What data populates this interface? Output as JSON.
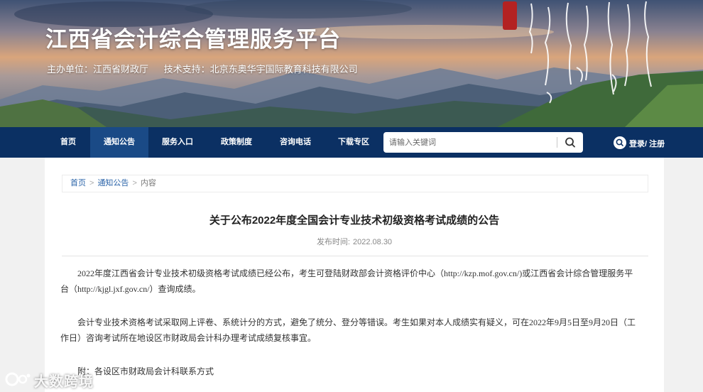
{
  "header": {
    "site_title": "江西省会计综合管理服务平台",
    "organizer": "主办单位：江西省财政厅",
    "tech_support": "技术支持：北京东奥华宇国际教育科技有限公司"
  },
  "nav": {
    "items": [
      {
        "label": "首页"
      },
      {
        "label": "通知公告"
      },
      {
        "label": "服务入口"
      },
      {
        "label": "政策制度"
      },
      {
        "label": "咨询电话"
      },
      {
        "label": "下载专区"
      }
    ],
    "active": "通知公告",
    "search": {
      "placeholder": "请输入关键词",
      "icon": "search-icon"
    },
    "login_label": "登录/ 注册",
    "colors": {
      "bar": "#0b3063",
      "active": "#1a4a86"
    }
  },
  "breadcrumb": {
    "items": [
      "首页",
      "通知公告"
    ],
    "current": "内容",
    "separator": ">"
  },
  "article": {
    "title": "关于公布2022年度全国会计专业技术初级资格考试成绩的公告",
    "publish_label": "发布时间:",
    "publish_date": "2022.08.30",
    "paragraphs": [
      "2022年度江西省会计专业技术初级资格考试成绩已经公布，考生可登陆财政部会计资格评价中心（http://kzp.mof.gov.cn/)或江西省会计综合管理服务平台（http://kjgl.jxf.gov.cn/）查询成绩。",
      "会计专业技术资格考试采取网上评卷、系统计分的方式，避免了统分、登分等错误。考生如果对本人成绩实有疑义，可在2022年9月5日至9月20日（工作日）咨询考试所在地设区市财政局会计科办理考试成绩复核事宜。",
      "附：各设区市财政局会计科联系方式"
    ]
  },
  "watermark": {
    "text": "大数跨境"
  }
}
